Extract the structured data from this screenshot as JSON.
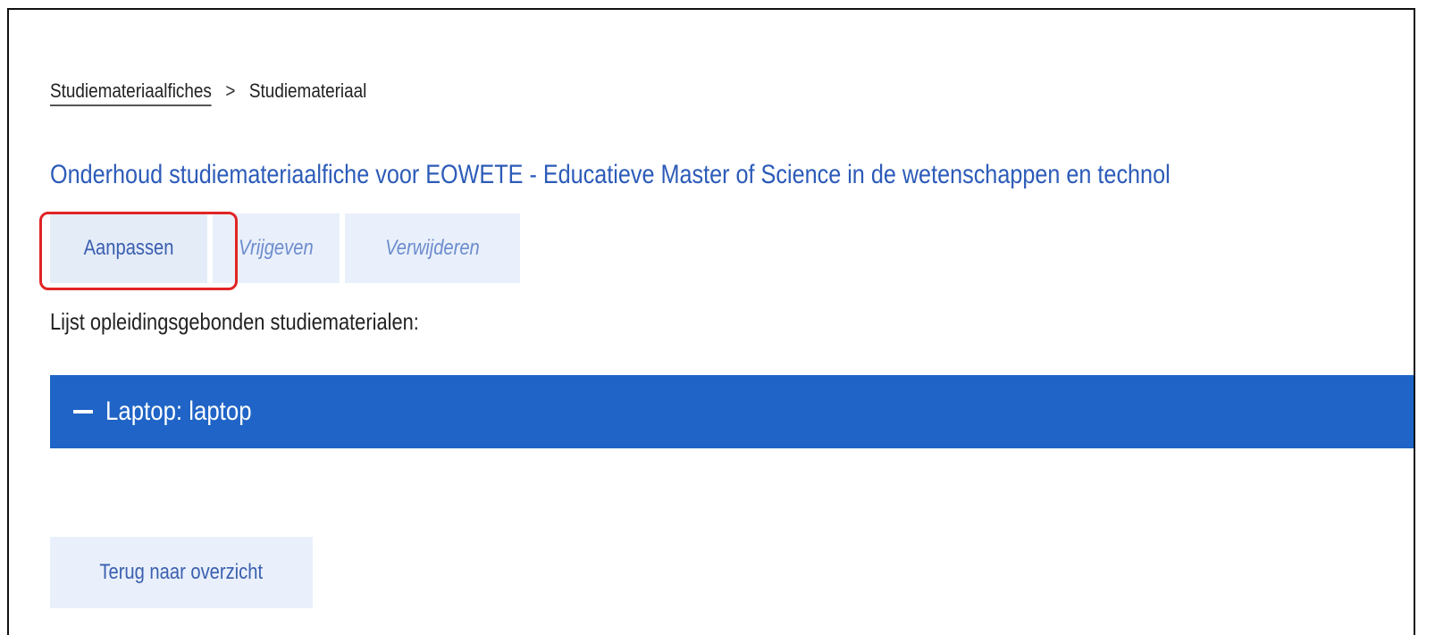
{
  "breadcrumb": {
    "link": "Studiemateriaalfiches",
    "separator": ">",
    "current": "Studiemateriaal"
  },
  "page_title": "Onderhoud studiemateriaalfiche voor EOWETE - Educatieve Master of Science in de wetenschappen en technol",
  "actions": {
    "edit": "Aanpassen",
    "release": "Vrijgeven",
    "delete": "Verwijderen"
  },
  "list_label": "Lijst opleidingsgebonden studiematerialen:",
  "accordion": {
    "toggle_icon": "minus-icon",
    "label": "Laptop: laptop"
  },
  "back_button": "Terug naar overzicht",
  "colors": {
    "accent_blue": "#1f64c6",
    "title_blue": "#2c5bb8",
    "button_bg": "#e9f0fb",
    "highlight_red": "#e02424"
  }
}
